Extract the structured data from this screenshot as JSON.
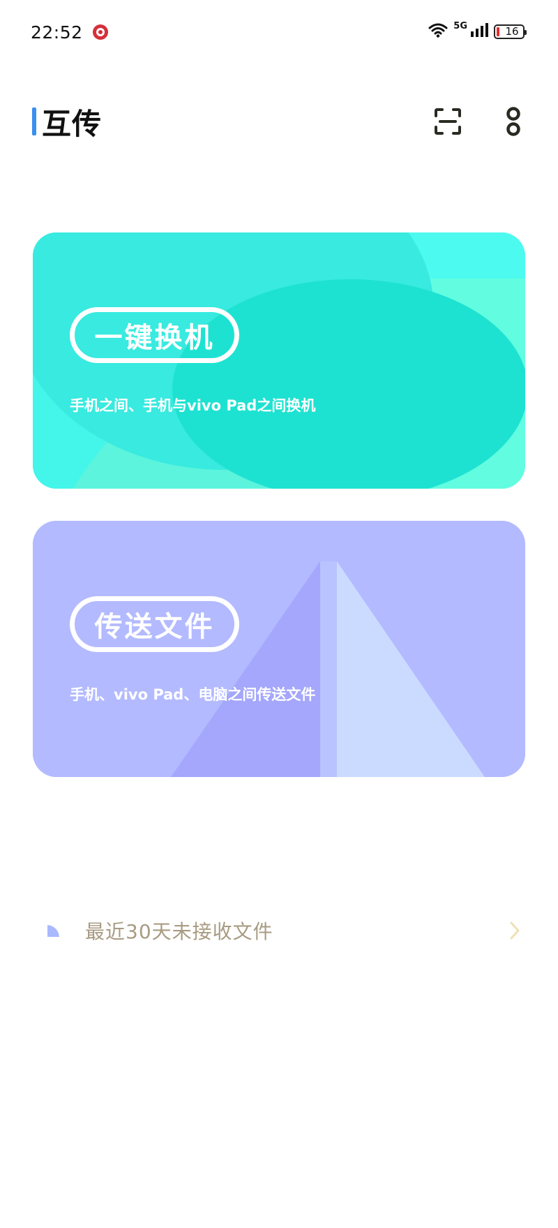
{
  "status_bar": {
    "time": "22:52",
    "network": "5G",
    "battery_level": "16",
    "icons": [
      "wifi-icon",
      "signal-icon",
      "battery-icon",
      "app-notification-icon"
    ]
  },
  "header": {
    "title": "互传",
    "actions": [
      "scan-icon",
      "more-options-icon"
    ]
  },
  "cards": [
    {
      "title": "一键换机",
      "subtitle": "手机之间、手机与vivo Pad之间换机",
      "color": "#3cf0e6"
    },
    {
      "title": "传送文件",
      "subtitle": "手机、vivo Pad、电脑之间传送文件",
      "color": "#b0b9ff"
    }
  ],
  "recent": {
    "label": "最近30天未接收文件",
    "icon": "pie-chart-icon",
    "chevron": "chevron-right-icon"
  },
  "colors": {
    "accent": "#3b8ff0",
    "card_teal": "#3cf0e6",
    "card_purple": "#b0b9ff",
    "muted_text": "#a89b82"
  }
}
